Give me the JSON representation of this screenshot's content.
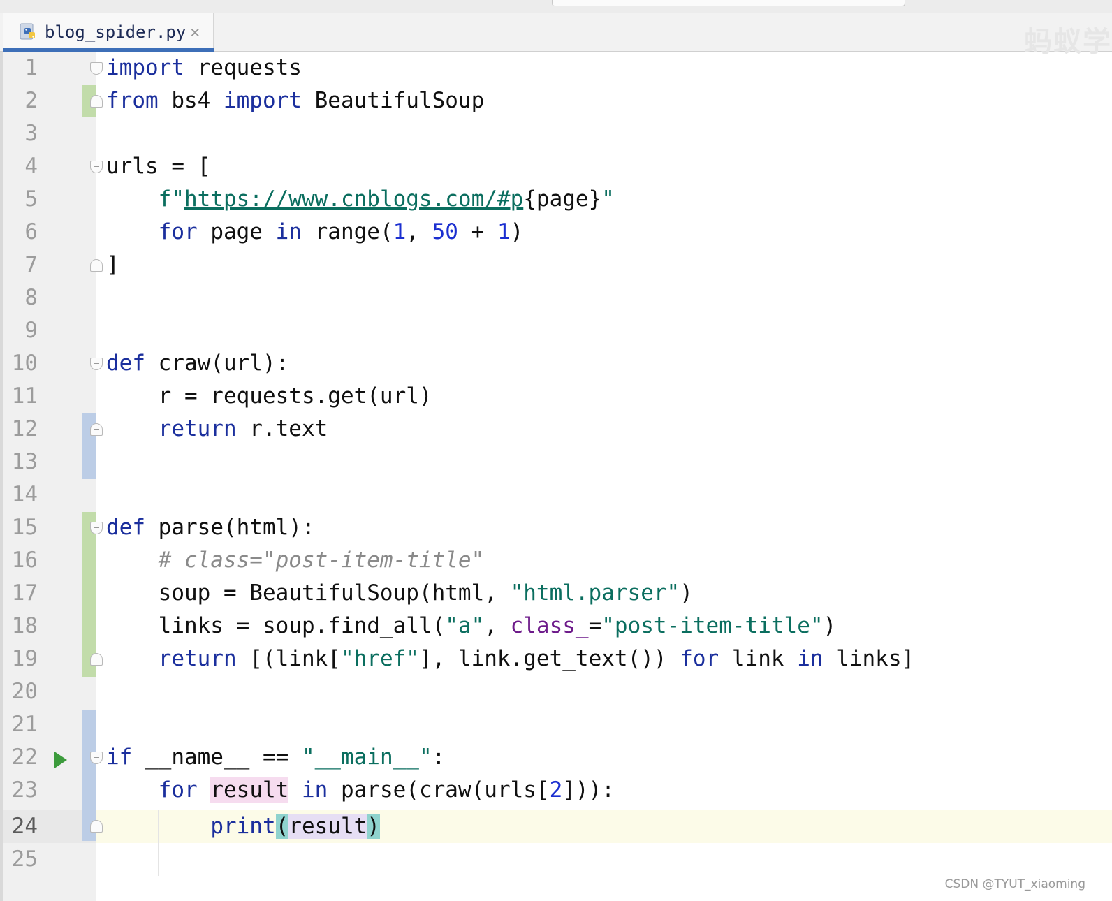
{
  "app": {
    "tab_title": "blog_spider.py",
    "tab_close": "×",
    "watermark": "蚂蚁学",
    "csdn_watermark": "CSDN @TYUT_xiaoming"
  },
  "editor": {
    "line_numbers": [
      "1",
      "2",
      "3",
      "4",
      "5",
      "6",
      "7",
      "8",
      "9",
      "10",
      "11",
      "12",
      "13",
      "14",
      "15",
      "16",
      "17",
      "18",
      "19",
      "20",
      "21",
      "22",
      "23",
      "24",
      "25"
    ],
    "current_line": "24",
    "code": {
      "l1": {
        "kw_import": "import",
        "rest": " requests"
      },
      "l2": {
        "kw_from": "from",
        "mod": " bs4 ",
        "kw_import": "import",
        "rest": " BeautifulSoup"
      },
      "l4": {
        "text": "urls = ["
      },
      "l5": {
        "indent": "    ",
        "prefix": "f\"",
        "url": "https://www.cnblogs.com/#p",
        "brace_open": "{",
        "var": "page",
        "brace_close": "}",
        "quote": "\""
      },
      "l6": {
        "indent": "    ",
        "kw_for": "for",
        "mid": " page ",
        "kw_in": "in",
        "call": " range(",
        "n1": "1",
        "sep": ", ",
        "n50": "50",
        "plus": " + ",
        "n1b": "1",
        "close": ")"
      },
      "l7": {
        "text": "]"
      },
      "l10": {
        "kw_def": "def",
        "rest": " craw(url):"
      },
      "l11": {
        "indent": "    ",
        "text": "r = requests.get(url)"
      },
      "l12": {
        "indent": "    ",
        "kw_return": "return",
        "rest": " r.text"
      },
      "l15": {
        "kw_def": "def",
        "rest": " parse(html):"
      },
      "l16": {
        "indent": "    ",
        "comment": "# class=\"post-item-title\""
      },
      "l17": {
        "indent": "    ",
        "pre": "soup = BeautifulSoup(html, ",
        "str": "\"html.parser\"",
        "post": ")"
      },
      "l18": {
        "indent": "    ",
        "pre": "links = soup.find_all(",
        "str_a": "\"a\"",
        "sep": ", ",
        "param": "class_",
        "eq": "=",
        "str_cls": "\"post-item-title\"",
        "post": ")"
      },
      "l19": {
        "indent": "    ",
        "kw_return": "return",
        "pre": " [(link[",
        "str_href": "\"href\"",
        "mid": "], link.get_text()) ",
        "kw_for": "for",
        "mid2": " link ",
        "kw_in": "in",
        "post": " links]"
      },
      "l22": {
        "kw_if": "if",
        "mid": " __name__ == ",
        "str_main": "\"__main__\"",
        "post": ":"
      },
      "l23": {
        "indent": "    ",
        "kw_for": "for",
        "sp": " ",
        "var": "result",
        "sp2": " ",
        "kw_in": "in",
        "post_a": " parse(craw(urls[",
        "num": "2",
        "post_b": "])):"
      },
      "l24": {
        "indent": "        ",
        "kw_print": "print",
        "paren_open": "(",
        "var": "result",
        "paren_close": ")"
      }
    }
  }
}
